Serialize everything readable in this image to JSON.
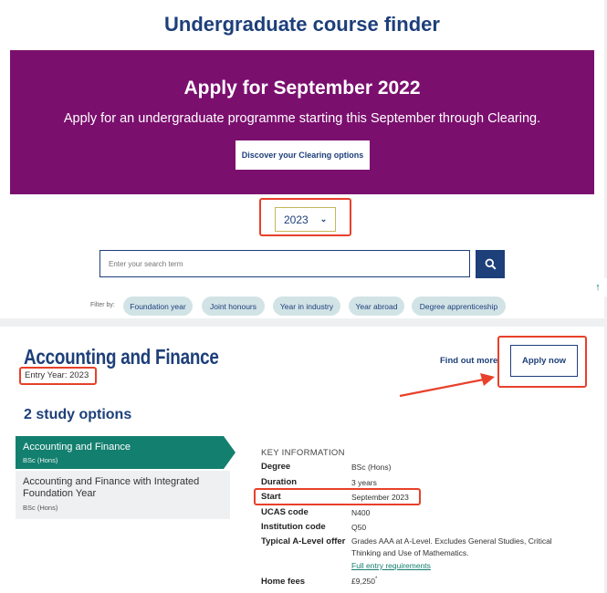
{
  "finder": {
    "title": "Undergraduate course finder",
    "banner": {
      "title": "Apply for September 2022",
      "subtitle": "Apply for an undergraduate programme starting this September through Clearing.",
      "button_label": "Discover your Clearing options",
      "color": "#7b0f6e"
    },
    "year_select": {
      "value": "2023"
    },
    "search": {
      "placeholder": "Enter your search term"
    },
    "filter_label": "Filter by:",
    "filters": [
      "Foundation year",
      "Joint honours",
      "Year in industry",
      "Year abroad",
      "Degree apprenticeship"
    ]
  },
  "course": {
    "title": "Accounting and Finance",
    "entry_year": "Entry Year: 2023",
    "find_out_more": "Find out more",
    "apply_now": "Apply now",
    "study_options_heading": "2 study options",
    "options": [
      {
        "title": "Accounting and Finance",
        "qualification": "BSc (Hons)"
      },
      {
        "title": "Accounting and Finance with Integrated Foundation Year",
        "qualification": "BSc (Hons)"
      }
    ],
    "key_info": {
      "heading": "KEY INFORMATION",
      "rows": [
        {
          "label": "Degree",
          "value": "BSc (Hons)"
        },
        {
          "label": "Duration",
          "value": "3 years"
        },
        {
          "label": "Start",
          "value": "September 2023"
        },
        {
          "label": "UCAS code",
          "value": "N400"
        },
        {
          "label": "Institution code",
          "value": "Q50"
        },
        {
          "label": "Typical A-Level offer",
          "value": "Grades AAA at A-Level. Excludes General Studies, Critical Thinking and Use of Mathematics."
        },
        {
          "label": "Home fees",
          "value": "£9,250"
        }
      ],
      "full_entry_link": "Full entry requirements",
      "home_fees_marker": "*"
    }
  },
  "colors": {
    "navy": "#1d3f7a",
    "teal": "#137f6f",
    "highlight": "#e8402a",
    "chip": "#d2e3e6"
  }
}
